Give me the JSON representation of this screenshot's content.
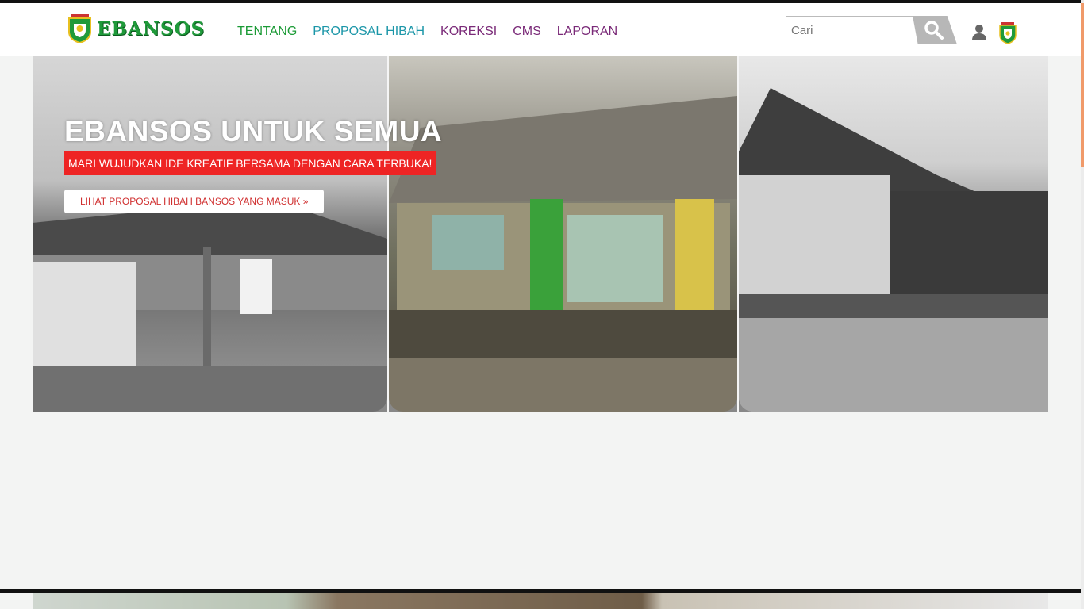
{
  "header": {
    "logo_text": "EBANSOS",
    "nav": [
      "TENTANG",
      "PROPOSAL HIBAH",
      "KOREKSI",
      "CMS",
      "LAPORAN"
    ],
    "search_placeholder": "Cari",
    "icons": [
      "search-icon",
      "user-icon",
      "banten-emblem-icon"
    ],
    "colors": {
      "green": "#1a9a35",
      "teal": "#1b96a8",
      "purple": "#7a2a78"
    }
  },
  "hero": {
    "title": "EBANSOS UNTUK SEMUA",
    "subtitle": "MARI WUJUDKAN IDE KREATIF BERSAMA DENGAN CARA TERBUKA!",
    "button_label": "LIHAT PROPOSAL HIBAH BANSOS YANG MASUK »",
    "colors": {
      "subtitle_bg": "#ee2424",
      "button_text": "#d03030"
    }
  }
}
